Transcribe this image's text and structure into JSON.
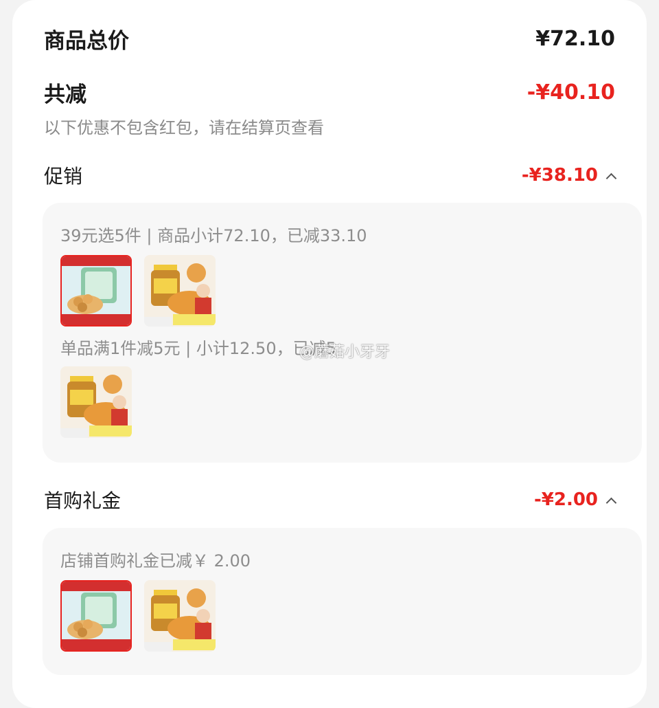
{
  "total": {
    "label": "商品总价",
    "value": "¥72.10"
  },
  "discount": {
    "label": "共减",
    "value": "-¥40.10",
    "note": "以下优惠不包含红包，请在结算页查看"
  },
  "promo": {
    "label": "促销",
    "value": "-¥38.10",
    "rules": [
      {
        "text": "39元选5件 | 商品小计72.10，已减33.10"
      },
      {
        "text": "单品满1件减5元 | 小计12.50，已减5"
      }
    ]
  },
  "gift": {
    "label": "首购礼金",
    "value": "-¥2.00",
    "rule": "店铺首购礼金已减￥ 2.00"
  },
  "watermark": "@蘑菇小牙牙",
  "colors": {
    "accent": "#e8231f",
    "card": "#ffffff",
    "panel": "#f7f7f7",
    "muted": "#8d8d8d"
  }
}
